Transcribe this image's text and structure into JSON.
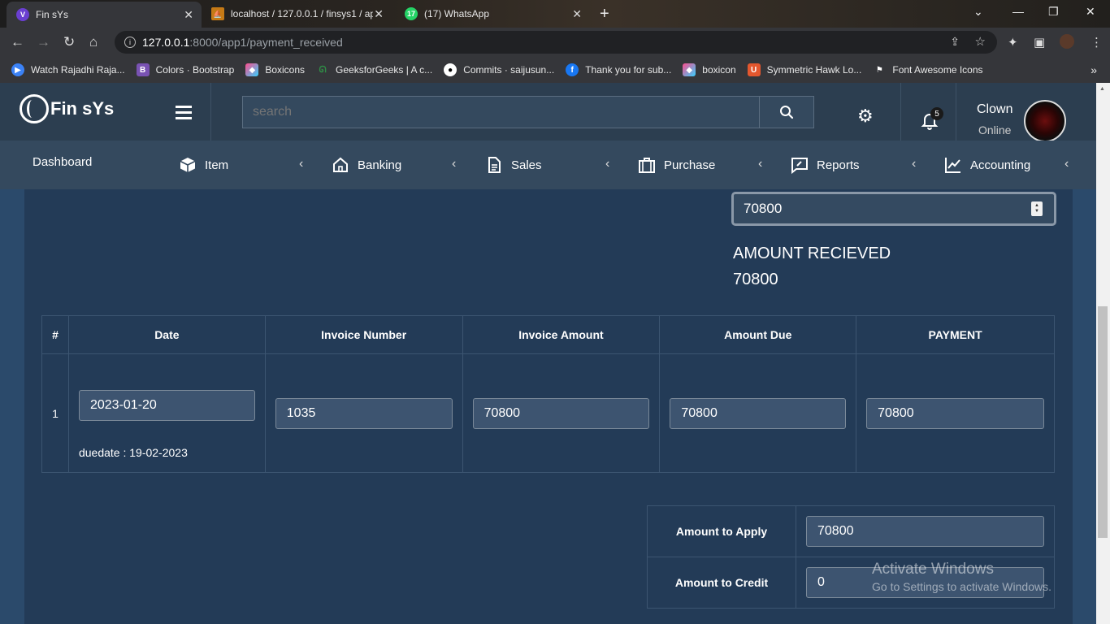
{
  "browser": {
    "tabs": [
      {
        "title": "Fin sYs",
        "active": true
      },
      {
        "title": "localhost / 127.0.0.1 / finsys1 / ap",
        "active": false
      },
      {
        "title": "(17) WhatsApp",
        "active": false,
        "badge": "17"
      }
    ],
    "url_host": "127.0.0.1",
    "url_path": ":8000/app1/payment_received",
    "bookmarks": [
      "Watch Rajadhi Raja...",
      "Colors · Bootstrap",
      "Boxicons",
      "GeeksforGeeks | A c...",
      "Commits · saijusun...",
      "Thank you for sub...",
      "boxicon",
      "Symmetric Hawk Lo...",
      "Font Awesome Icons"
    ]
  },
  "header": {
    "brand": "Fin sYs",
    "search_placeholder": "search",
    "notification_count": "5",
    "user_name": "Clown",
    "user_status": "Online"
  },
  "nav": {
    "dashboard": "Dashboard",
    "items": [
      "Item",
      "Banking",
      "Sales",
      "Purchase",
      "Reports",
      "Accounting"
    ]
  },
  "payment": {
    "amount_input": "70800",
    "amount_received_label": "AMOUNT RECIEVED",
    "amount_received_value": "70800"
  },
  "table": {
    "headers": [
      "#",
      "Date",
      "Invoice Number",
      "Invoice Amount",
      "Amount Due",
      "PAYMENT"
    ],
    "rows": [
      {
        "index": "1",
        "date": "2023-01-20",
        "due_date": "duedate : 19-02-2023",
        "invoice_number": "1035",
        "invoice_amount": "70800",
        "amount_due": "70800",
        "payment": "70800"
      }
    ]
  },
  "summary": {
    "apply_label": "Amount to Apply",
    "apply_value": "70800",
    "credit_label": "Amount to Credit",
    "credit_value": "0"
  },
  "watermark": {
    "line1": "Activate Windows",
    "line2": "Go to Settings to activate Windows."
  }
}
